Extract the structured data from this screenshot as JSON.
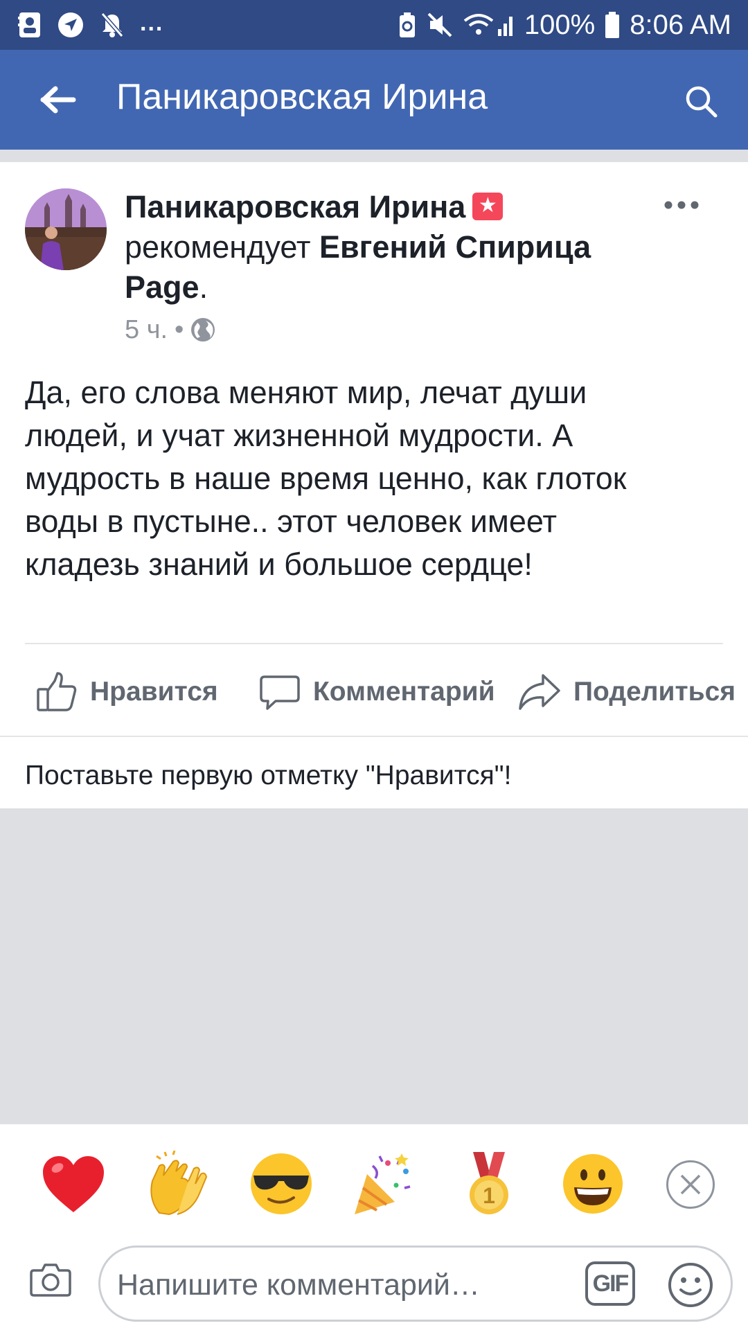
{
  "status_bar": {
    "more": "...",
    "battery_percent": "100%",
    "time": "8:06 AM"
  },
  "header": {
    "title": "Паникаровская Ирина"
  },
  "post": {
    "author": "Паникаровская Ирина",
    "author_badge": "★",
    "recommends_text": "рекомендует",
    "page_name": "Евгений Спирица Page",
    "period": ".",
    "time_ago": "5 ч.",
    "meta_separator": "•",
    "privacy_icon": "globe-icon",
    "body": "Да, его слова меняют мир, лечат души\nлюдей, и учат жизненной мудрости. А\nмудрость в наше время ценно, как глоток\nводы в пустыне.. этот человек имеет\nкладезь знаний  и большое сердце!"
  },
  "actions": {
    "like": "Нравится",
    "comment": "Комментарий",
    "share": "Поделиться"
  },
  "first_like_prompt": "Поставьте первую отметку \"Нравится\"!",
  "stickers": [
    "heart",
    "clapping-hands",
    "cool-face",
    "party-popper",
    "first-place-medal",
    "grinning-face"
  ],
  "composer": {
    "placeholder": "Напишите комментарий…",
    "gif_label": "GIF"
  },
  "colors": {
    "status_bar": "#2f4a85",
    "header": "#4267b2",
    "divider": "#dddfe2",
    "text_secondary": "#606770"
  }
}
